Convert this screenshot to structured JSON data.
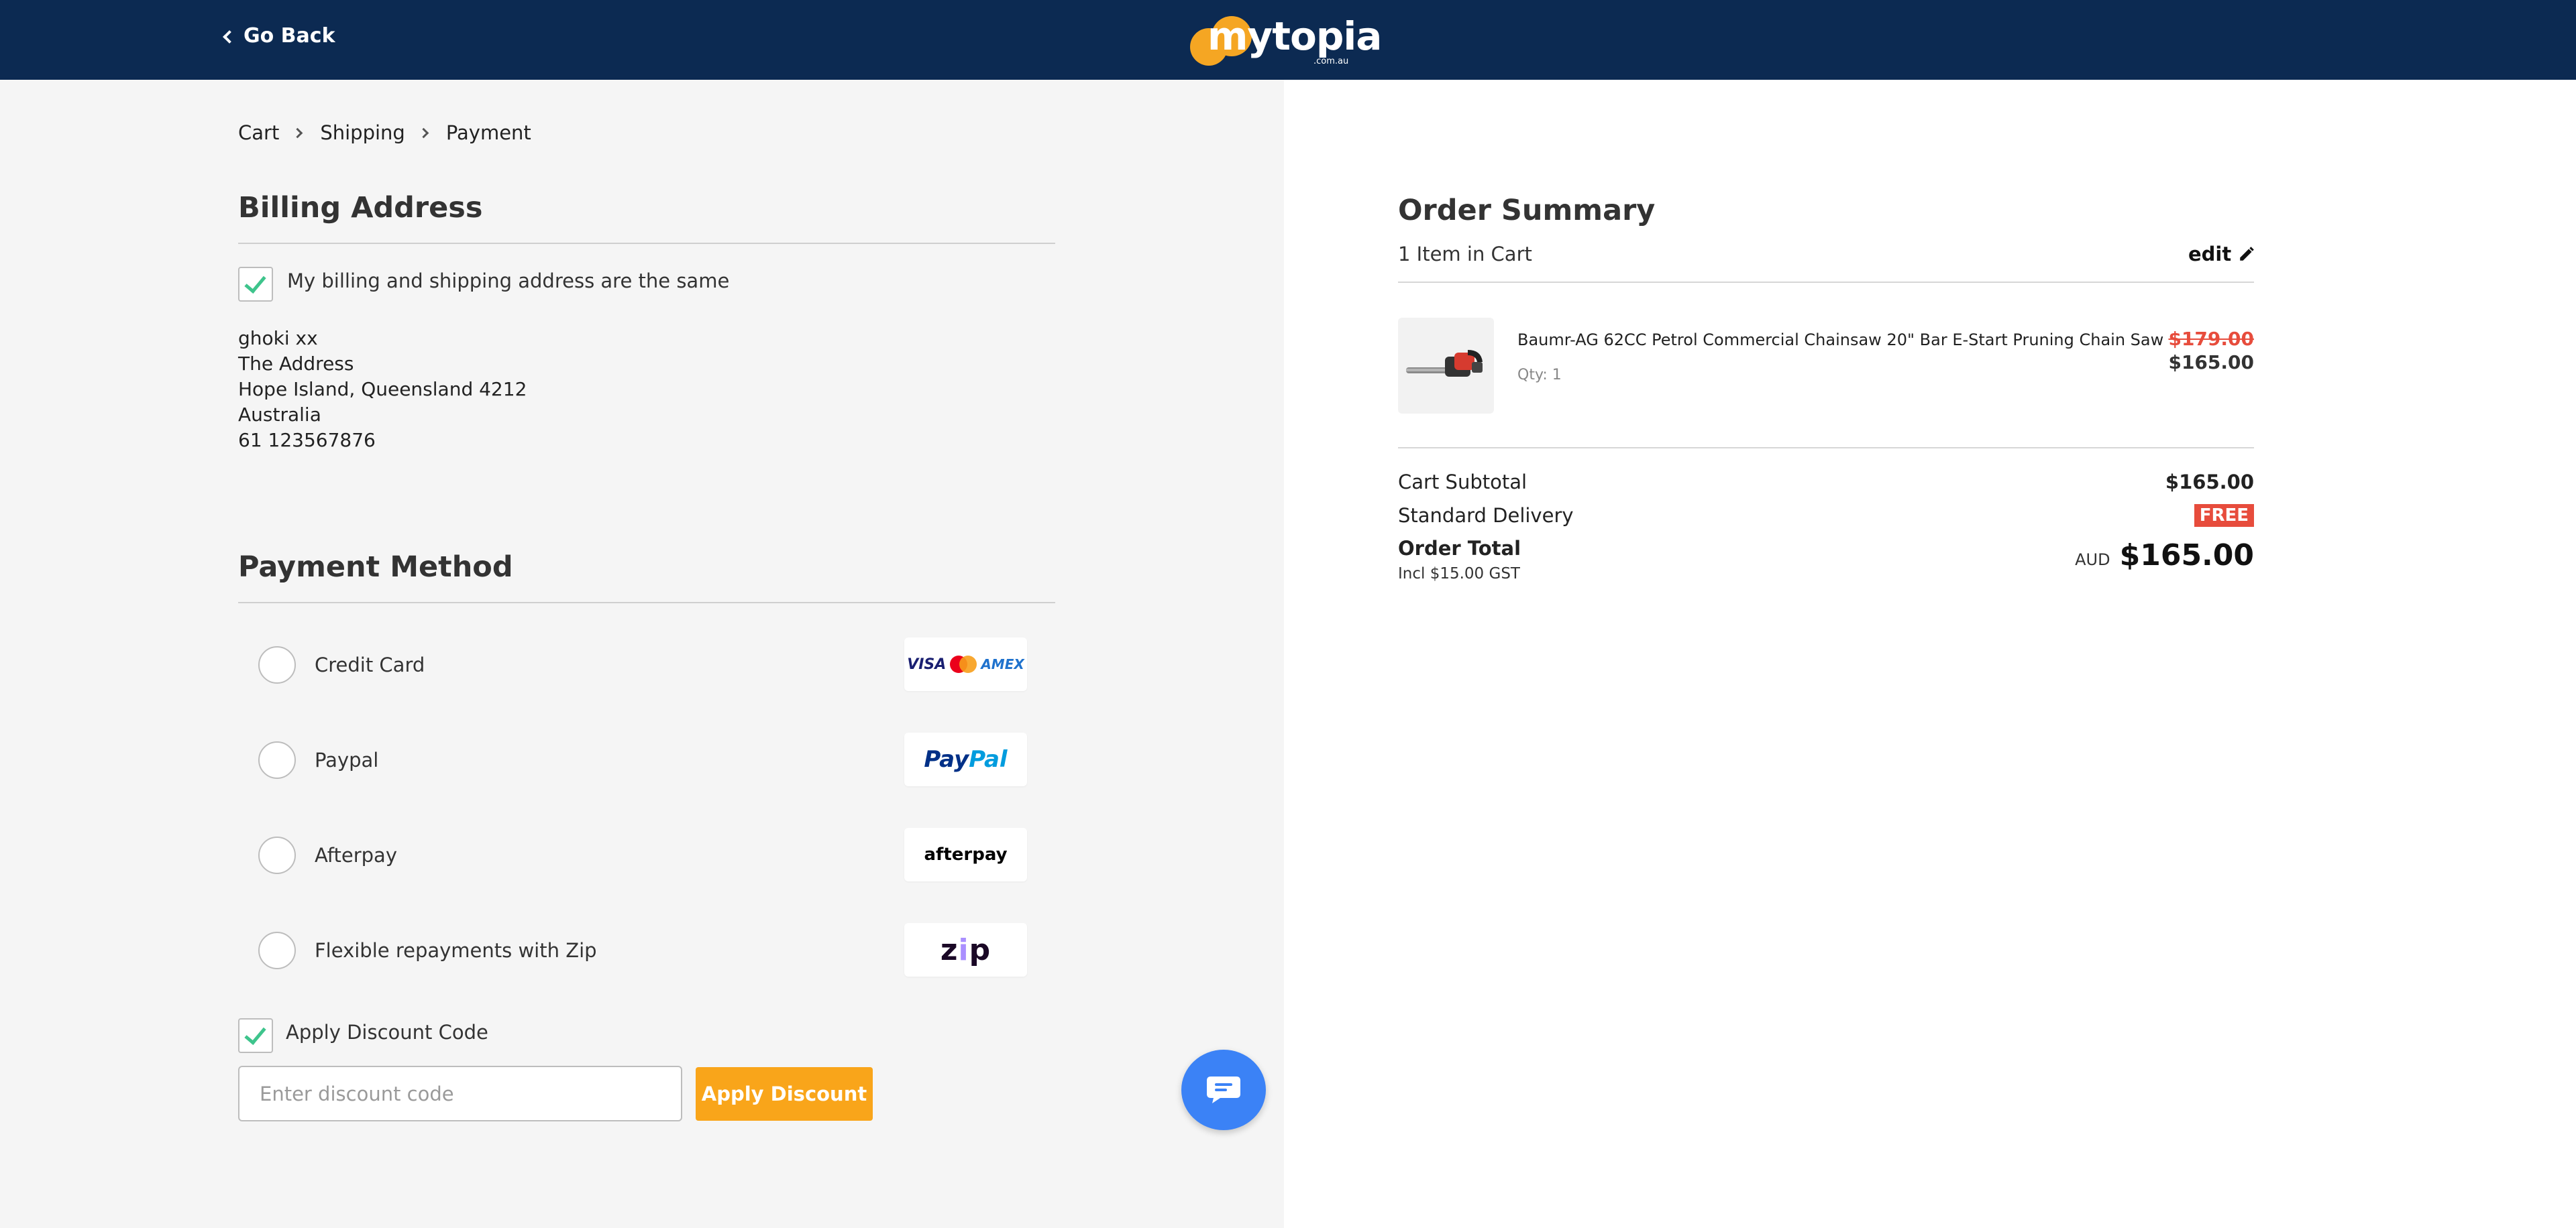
{
  "header": {
    "go_back_label": "Go Back",
    "logo_text": "mytopia",
    "logo_sub": ".com.au"
  },
  "breadcrumb": [
    "Cart",
    "Shipping",
    "Payment"
  ],
  "billing": {
    "title": "Billing Address",
    "same_address_label": "My billing and shipping address are the same",
    "same_address_checked": true,
    "address_lines": [
      "ghoki xx",
      "The Address",
      "Hope Island, Queensland 4212",
      "Australia",
      "61 123567876"
    ]
  },
  "payment": {
    "title": "Payment Method",
    "methods": [
      {
        "label": "Credit Card",
        "logo": "visa-mastercard-amex"
      },
      {
        "label": "Paypal",
        "logo": "paypal"
      },
      {
        "label": "Afterpay",
        "logo": "afterpay"
      },
      {
        "label": "Flexible repayments with Zip",
        "logo": "zip"
      }
    ],
    "logo_text": {
      "visa": "VISA",
      "amex": "AMEX",
      "paypal_a": "Pay",
      "paypal_b": "Pal",
      "afterpay": "afterpay",
      "zip_a": "z",
      "zip_b": "i",
      "zip_c": "p"
    }
  },
  "discount": {
    "toggle_label": "Apply Discount Code",
    "toggle_checked": true,
    "input_placeholder": "Enter discount code",
    "input_value": "",
    "apply_label": "Apply Discount"
  },
  "summary": {
    "title": "Order Summary",
    "items_count": "1 Item in Cart",
    "edit_label": "edit",
    "item": {
      "name": "Baumr-AG 62CC Petrol Commercial Chainsaw 20\" Bar E-Start Pruning Chain Saw",
      "qty": "Qty: 1",
      "old_price": "$179.00",
      "price": "$165.00"
    },
    "subtotal_label": "Cart Subtotal",
    "subtotal_value": "$165.00",
    "delivery_label": "Standard Delivery",
    "delivery_value": "FREE",
    "total_label": "Order Total",
    "gst_note": "Incl $15.00 GST",
    "currency": "AUD",
    "total_value": "$165.00"
  },
  "colors": {
    "header_bg": "#0c2a52",
    "accent_orange": "#f9a51a",
    "sale_red": "#e74c3c",
    "check_green": "#3ec48c",
    "chat_blue": "#3b82f6"
  },
  "icons": {
    "back": "chevron-left-icon",
    "edit": "pencil-icon",
    "chat": "chat-bubble-icon"
  }
}
